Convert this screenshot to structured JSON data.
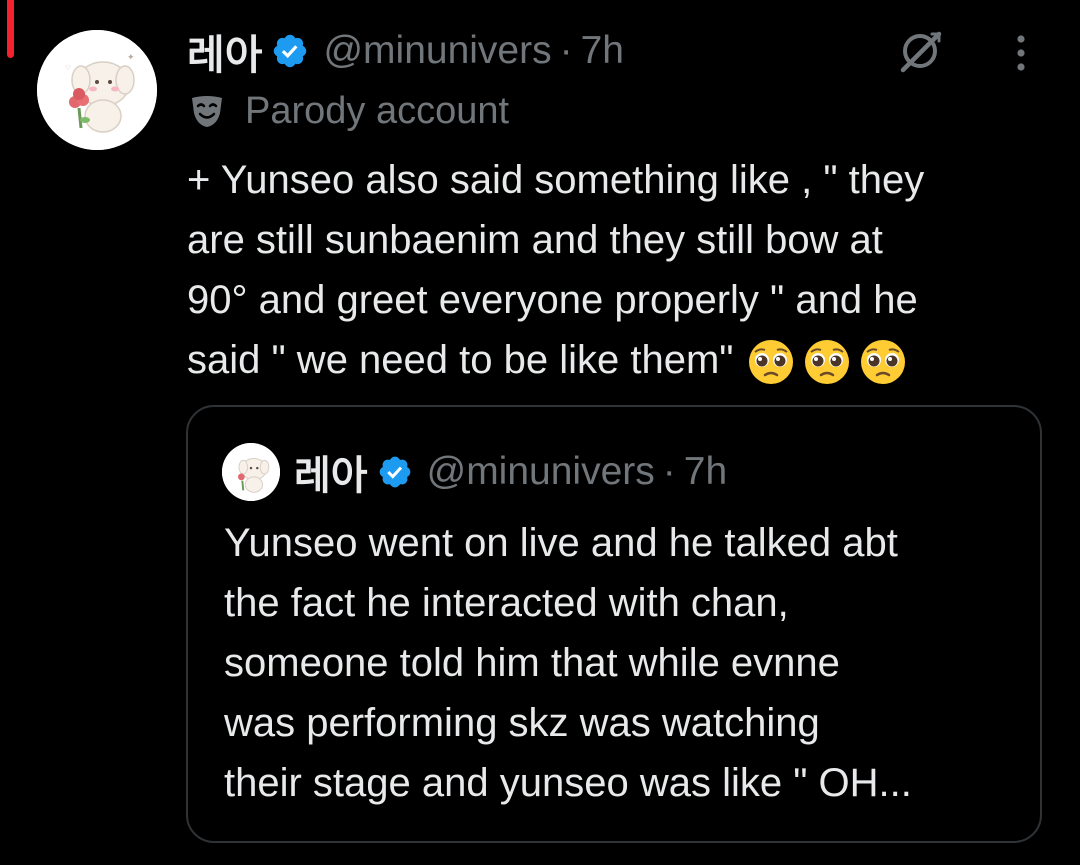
{
  "tweet": {
    "author_name": "레아",
    "handle": "@minunivers",
    "separator": "·",
    "time": "7h",
    "account_label": "Parody account",
    "text_lines": [
      "+ Yunseo also said something like , \" they",
      "are still sunbaenim and they still bow at",
      "90° and greet everyone properly \"  and he",
      "said \" we need to be like them\""
    ],
    "emoji_icons": [
      "pleading-face",
      "pleading-face",
      "pleading-face"
    ]
  },
  "quoted_tweet": {
    "author_name": "레아",
    "handle": "@minunivers",
    "separator": "·",
    "time": "7h",
    "text_lines": [
      "Yunseo went on live and he talked abt",
      "the fact he interacted with chan,",
      "someone told him that while evnne",
      "was performing skz was watching",
      "their stage and yunseo was like \" OH..."
    ]
  },
  "icons": {
    "verified": "verified-badge-icon",
    "grok": "grok-icon",
    "more": "more-options-icon",
    "parody": "theater-mask-icon"
  },
  "colors": {
    "background": "#000000",
    "primary_text": "#e7e9ea",
    "secondary_text": "#71767b",
    "verified_blue": "#1d9bf0",
    "quote_border": "#2f3336",
    "thread_accent": "#f4212e"
  }
}
